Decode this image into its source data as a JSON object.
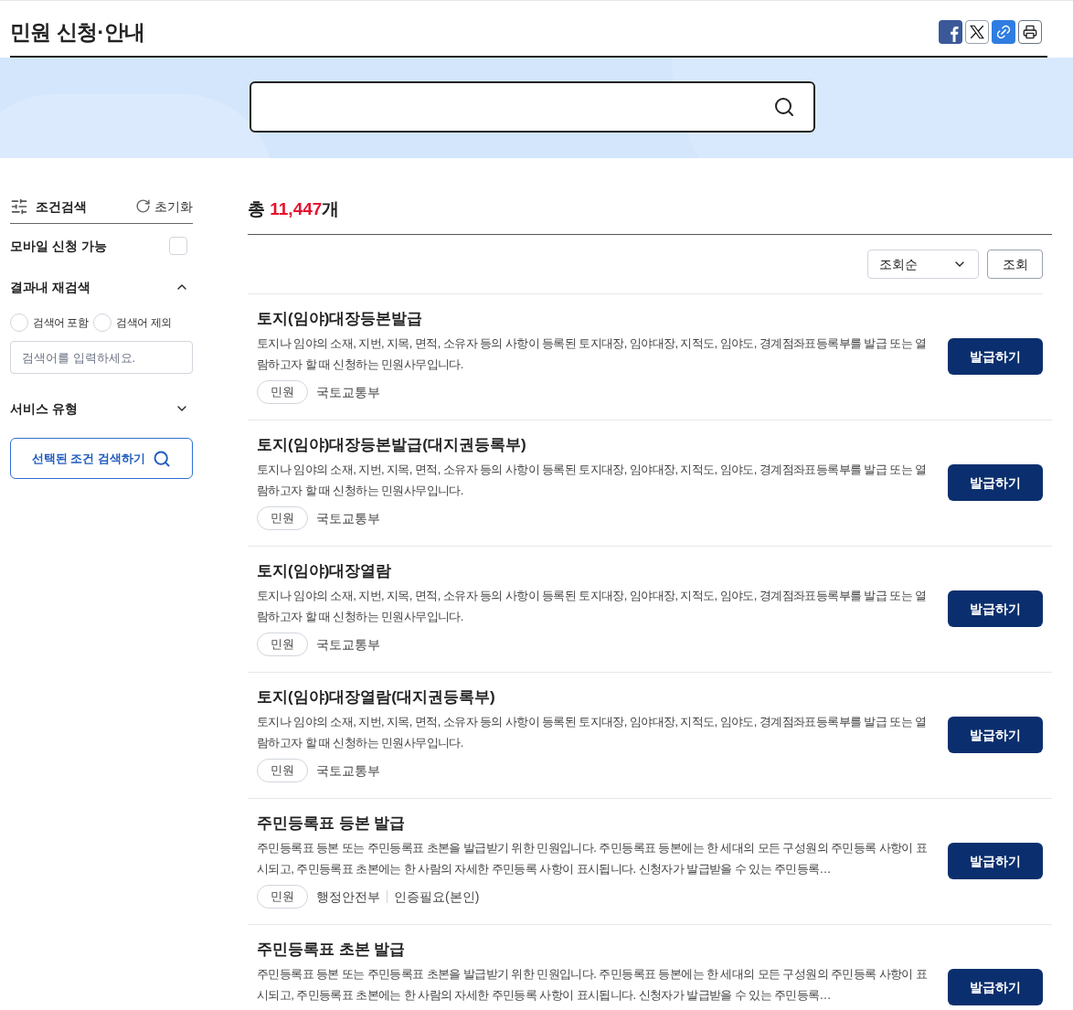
{
  "page_title": "민원 신청·안내",
  "sidebar": {
    "title": "조건검색",
    "reset": "초기화",
    "mobile": {
      "label": "모바일 신청 가능",
      "checked": false
    },
    "refine": {
      "title": "결과내 재검색",
      "expanded": true,
      "options": [
        {
          "label": "검색어 포함",
          "selected": false
        },
        {
          "label": "검색어 제외",
          "selected": false
        }
      ],
      "placeholder": "검색어를 입력하세요."
    },
    "service_type": {
      "title": "서비스 유형",
      "expanded": false
    },
    "submit": "선택된 조건 검색하기"
  },
  "summary": {
    "prefix": "총",
    "count": "11,447",
    "suffix": "개"
  },
  "sort": {
    "value": "조회순",
    "button": "조회"
  },
  "results": [
    {
      "title": "토지(임야)대장등본발급",
      "description": "토지나 임야의 소재, 지번, 지목, 면적, 소유자 등의 사항이 등록된 토지대장, 임야대장, 지적도, 임야도, 경계점좌표등록부를 발급 또는 열람하고자 할 때 신청하는 민원사무입니다.",
      "category": "민원",
      "agency": "국토교통부",
      "button": "발급하기"
    },
    {
      "title": "토지(임야)대장등본발급(대지권등록부)",
      "description": "토지나 임야의 소재, 지번, 지목, 면적, 소유자 등의 사항이 등록된 토지대장, 임야대장, 지적도, 임야도, 경계점좌표등록부를 발급 또는 열람하고자 할 때 신청하는 민원사무입니다.",
      "category": "민원",
      "agency": "국토교통부",
      "button": "발급하기"
    },
    {
      "title": "토지(임야)대장열람",
      "description": "토지나 임야의 소재, 지번, 지목, 면적, 소유자 등의 사항이 등록된 토지대장, 임야대장, 지적도, 임야도, 경계점좌표등록부를 발급 또는 열람하고자 할 때 신청하는 민원사무입니다.",
      "category": "민원",
      "agency": "국토교통부",
      "button": "발급하기"
    },
    {
      "title": "토지(임야)대장열람(대지권등록부)",
      "description": "토지나 임야의 소재, 지번, 지목, 면적, 소유자 등의 사항이 등록된 토지대장, 임야대장, 지적도, 임야도, 경계점좌표등록부를 발급 또는 열람하고자 할 때 신청하는 민원사무입니다.",
      "category": "민원",
      "agency": "국토교통부",
      "button": "발급하기"
    },
    {
      "title": "주민등록표 등본 발급",
      "description": "주민등록표 등본 또는 주민등록표 초본을 발급받기 위한 민원입니다. 주민등록표 등본에는 한 세대의 모든 구성원의 주민등록 사항이 표시되고, 주민등록표 초본에는 한 사람의 자세한 주민등록 사항이 표시됩니다. 신청자가 발급받을 수 있는 주민등록…",
      "category": "민원",
      "agency": "행정안전부",
      "note": "인증필요(본인)",
      "button": "발급하기"
    },
    {
      "title": "주민등록표 초본 발급",
      "description": "주민등록표 등본 또는 주민등록표 초본을 발급받기 위한 민원입니다. 주민등록표 등본에는 한 세대의 모든 구성원의 주민등록 사항이 표시되고, 주민등록표 초본에는 한 사람의 자세한 주민등록 사항이 표시됩니다. 신청자가 발급받을 수 있는 주민등록…",
      "button": "발급하기"
    }
  ]
}
